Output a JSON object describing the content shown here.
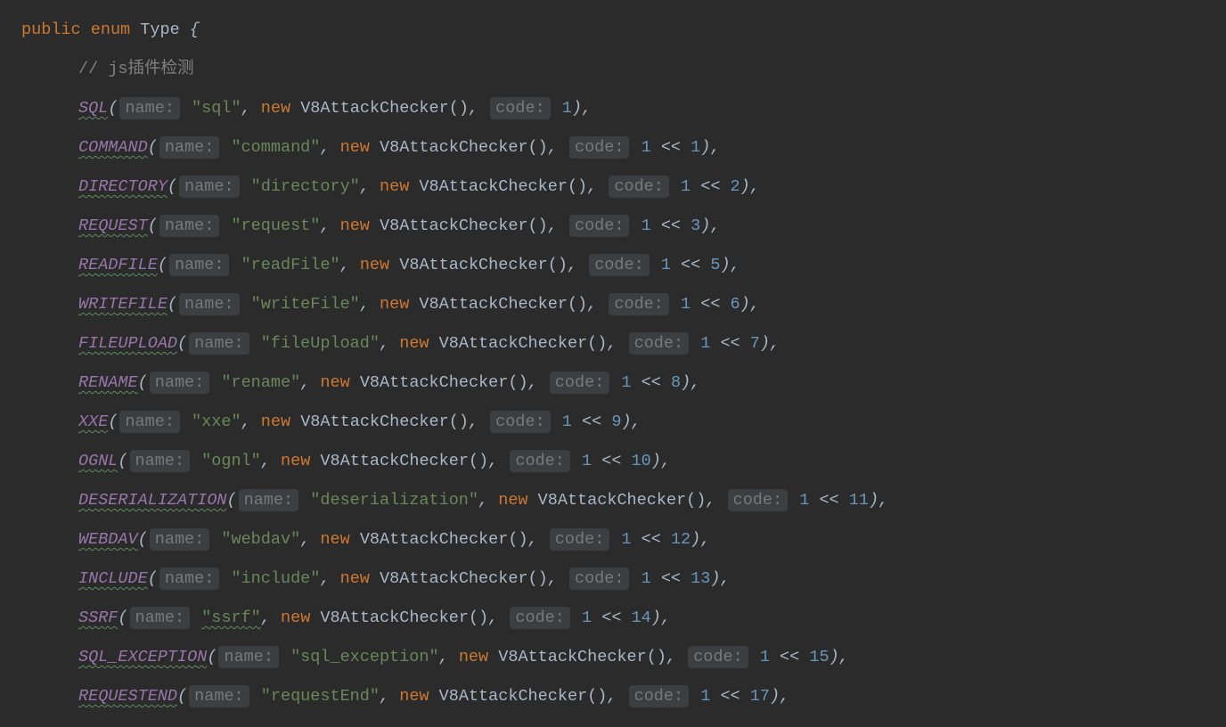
{
  "decl": {
    "public": "public",
    "enum": "enum",
    "type": "Type",
    "open": "{"
  },
  "comment": "// js插件检测",
  "hints": {
    "name": "name:",
    "code": "code:"
  },
  "kw": {
    "new": "new"
  },
  "ctor": "V8AttackChecker()",
  "entries": [
    {
      "const": "SQL",
      "str": "\"sql\"",
      "code": "1"
    },
    {
      "const": "COMMAND",
      "str": "\"command\"",
      "code": "1 << 1"
    },
    {
      "const": "DIRECTORY",
      "str": "\"directory\"",
      "code": "1 << 2"
    },
    {
      "const": "REQUEST",
      "str": "\"request\"",
      "code": "1 << 3"
    },
    {
      "const": "READFILE",
      "str": "\"readFile\"",
      "code": "1 << 5"
    },
    {
      "const": "WRITEFILE",
      "str": "\"writeFile\"",
      "code": "1 << 6"
    },
    {
      "const": "FILEUPLOAD",
      "str": "\"fileUpload\"",
      "code": "1 << 7"
    },
    {
      "const": "RENAME",
      "str": "\"rename\"",
      "code": "1 << 8"
    },
    {
      "const": "XXE",
      "str": "\"xxe\"",
      "code": "1 << 9"
    },
    {
      "const": "OGNL",
      "str": "\"ognl\"",
      "code": "1 << 10"
    },
    {
      "const": "DESERIALIZATION",
      "str": "\"deserialization\"",
      "code": "1 << 11"
    },
    {
      "const": "WEBDAV",
      "str": "\"webdav\"",
      "code": "1 << 12"
    },
    {
      "const": "INCLUDE",
      "str": "\"include\"",
      "code": "1 << 13"
    },
    {
      "const": "SSRF",
      "str": "\"ssrf\"",
      "code": "1 << 14",
      "strU": true
    },
    {
      "const": "SQL_EXCEPTION",
      "str": "\"sql_exception\"",
      "code": "1 << 15"
    },
    {
      "const": "REQUESTEND",
      "str": "\"requestEnd\"",
      "code": "1 << 17"
    }
  ]
}
